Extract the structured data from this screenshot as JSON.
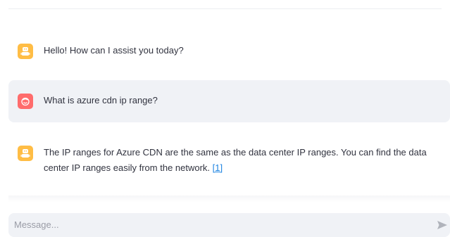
{
  "messages": [
    {
      "role": "assistant",
      "avatar_icon": "bot-icon",
      "text": "Hello! How can I assist you today?"
    },
    {
      "role": "user",
      "avatar_icon": "user-face-icon",
      "text": "What is azure cdn ip range?"
    },
    {
      "role": "assistant",
      "avatar_icon": "bot-icon",
      "text": "The IP ranges for Azure CDN are the same as the data center IP ranges. You can find the data center IP ranges easily from the network.",
      "citation": "[1]"
    }
  ],
  "input": {
    "placeholder": "Message...",
    "value": ""
  },
  "send_icon": "send-arrow-icon",
  "colors": {
    "assistant_avatar": "#ffbd45",
    "user_avatar": "#ff6c6c",
    "user_bubble": "#f0f2f6",
    "input_background": "#f0f2f6",
    "text": "#31333f",
    "link": "#1c83e1"
  }
}
